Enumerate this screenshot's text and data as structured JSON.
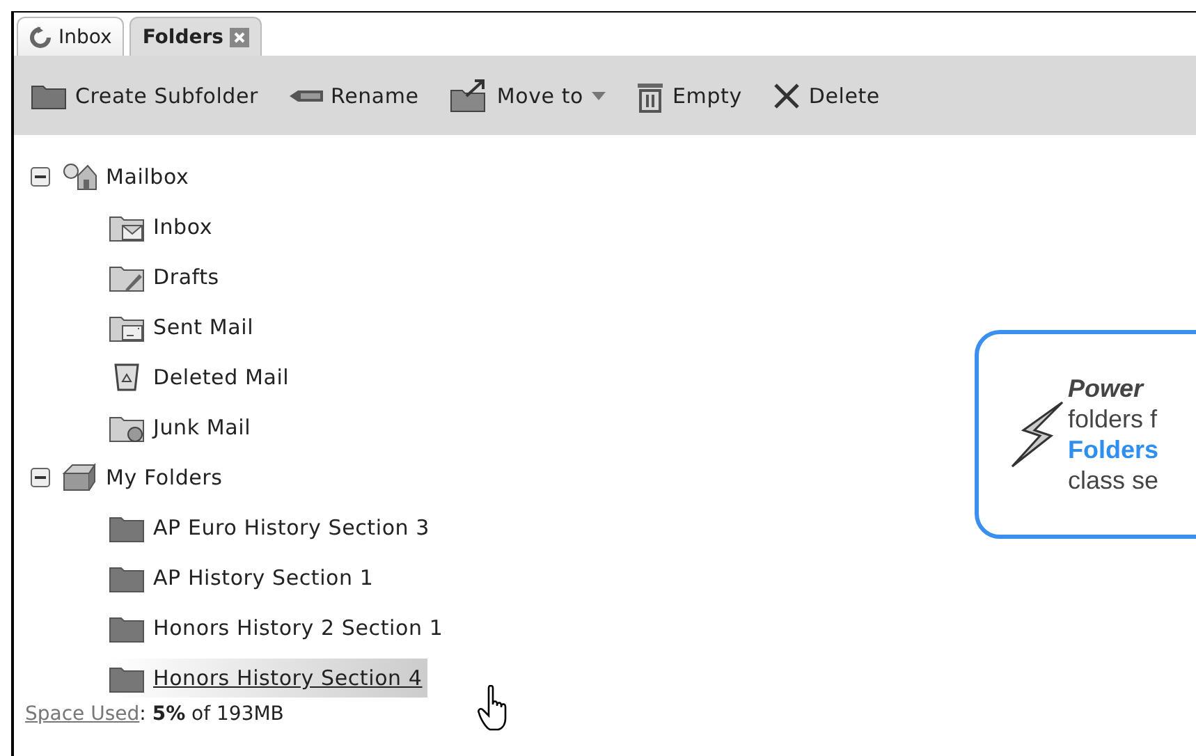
{
  "tabs": [
    {
      "label": "Inbox",
      "kind": "refresh",
      "selected": false
    },
    {
      "label": "Folders",
      "kind": "closable",
      "selected": true
    }
  ],
  "toolbar": [
    {
      "label": "Create Subfolder",
      "kind": "folder",
      "dropdown": false
    },
    {
      "label": "Rename",
      "kind": "rename",
      "dropdown": false
    },
    {
      "label": "Move to",
      "kind": "move",
      "dropdown": true
    },
    {
      "label": "Empty",
      "kind": "trash",
      "dropdown": false
    },
    {
      "label": "Delete",
      "kind": "delete",
      "dropdown": false
    }
  ],
  "tree": [
    {
      "label": "Mailbox",
      "kind": "mailbox",
      "expanded": true,
      "children": [
        {
          "label": "Inbox",
          "kind": "inbox",
          "hovered": false
        },
        {
          "label": "Drafts",
          "kind": "drafts",
          "hovered": false
        },
        {
          "label": "Sent Mail",
          "kind": "sent",
          "hovered": false
        },
        {
          "label": "Deleted Mail",
          "kind": "deleted",
          "hovered": false
        },
        {
          "label": "Junk Mail",
          "kind": "junk",
          "hovered": false
        }
      ]
    },
    {
      "label": "My Folders",
      "kind": "folders",
      "expanded": true,
      "children": [
        {
          "label": "AP Euro History Section 3",
          "kind": "folder",
          "hovered": false
        },
        {
          "label": "AP History Section 1",
          "kind": "folder",
          "hovered": false
        },
        {
          "label": "Honors History 2 Section 1",
          "kind": "folder",
          "hovered": false
        },
        {
          "label": "Honors History Section 4",
          "kind": "folder",
          "hovered": true
        }
      ]
    }
  ],
  "space_used": {
    "link": "Space Used",
    "value": ": **5%** of 193MB"
  },
  "callout": {
    "lines": [
      {
        "text": "Power",
        "kind": "title"
      },
      {
        "text": "folders f",
        "kind": "plain"
      },
      {
        "text": "Folders",
        "kind": "highlight"
      },
      {
        "text": "class se",
        "kind": "plain"
      }
    ]
  }
}
